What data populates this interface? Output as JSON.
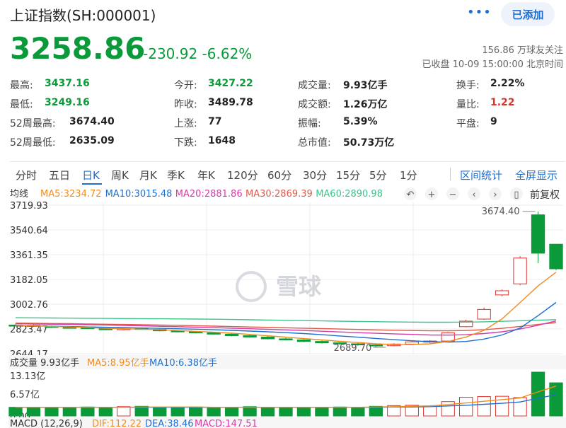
{
  "header": {
    "title": "上证指数(SH:000001)",
    "more_label": "•••",
    "add_label": "已添加",
    "price": "3258.86",
    "change": "-230.92 -6.62%",
    "follow": "156.86 万球友关注",
    "status": "已收盘 10-09 15:00:00 北京时间"
  },
  "stats": [
    [
      {
        "label": "最高:",
        "value": "3437.16",
        "color": "green"
      },
      {
        "label": "今开:",
        "value": "3427.22",
        "color": "green"
      },
      {
        "label": "成交量:",
        "value": "9.93亿手",
        "color": ""
      },
      {
        "label": "换手:",
        "value": "2.22%",
        "color": ""
      }
    ],
    [
      {
        "label": "最低:",
        "value": "3249.16",
        "color": "green"
      },
      {
        "label": "昨收:",
        "value": "3489.78",
        "color": ""
      },
      {
        "label": "成交额:",
        "value": "1.26万亿",
        "color": ""
      },
      {
        "label": "量比:",
        "value": "1.22",
        "color": "red"
      }
    ],
    [
      {
        "label": "52周最高:",
        "value": "3674.40",
        "color": ""
      },
      {
        "label": "上涨:",
        "value": "77",
        "color": ""
      },
      {
        "label": "振幅:",
        "value": "5.39%",
        "color": ""
      },
      {
        "label": "平盘:",
        "value": "9",
        "color": ""
      }
    ],
    [
      {
        "label": "52周最低:",
        "value": "2635.09",
        "color": ""
      },
      {
        "label": "下跌:",
        "value": "1648",
        "color": ""
      },
      {
        "label": "总市值:",
        "value": "50.73万亿",
        "color": ""
      }
    ]
  ],
  "tabs": [
    "分时",
    "五日",
    "日K",
    "周K",
    "月K",
    "季K",
    "年K",
    "120分",
    "60分",
    "30分",
    "15分",
    "5分",
    "1分"
  ],
  "active_tab": "日K",
  "tab_links": [
    "区间统计",
    "全屏显示"
  ],
  "chart_toolbar": {
    "mode": "均线",
    "fq": "前复权",
    "icons": [
      "↶",
      "+",
      "−",
      "‹",
      "›",
      "▯"
    ]
  },
  "watermark": "雪球",
  "colors": {
    "up": "#e0302a",
    "down": "#0a9a3a",
    "ma5": "#f08c1e",
    "ma10": "#1f6fd1",
    "ma20": "#d63ca8",
    "ma30": "#e05a4a",
    "ma60": "#3cc48c"
  },
  "chart_data": {
    "type": "candlestick",
    "price_ticks": [
      "3719.93",
      "3540.64",
      "3361.35",
      "3182.05",
      "3002.76",
      "2823.47",
      "2644.17"
    ],
    "price_range": [
      2644.17,
      3719.93
    ],
    "ma_legend": [
      {
        "name": "MA5",
        "value": "3234.72",
        "key": "ma5"
      },
      {
        "name": "MA10",
        "value": "3015.48",
        "key": "ma10"
      },
      {
        "name": "MA20",
        "value": "2881.86",
        "key": "ma20"
      },
      {
        "name": "MA30",
        "value": "2869.39",
        "key": "ma30"
      },
      {
        "name": "MA60",
        "value": "2890.98",
        "key": "ma60"
      }
    ],
    "annotations": {
      "high": "3674.40",
      "low": "2689.70"
    },
    "candles": [
      {
        "o": 2852,
        "h": 2860,
        "l": 2845,
        "c": 2848
      },
      {
        "o": 2850,
        "h": 2856,
        "l": 2839,
        "c": 2842
      },
      {
        "o": 2842,
        "h": 2848,
        "l": 2830,
        "c": 2835
      },
      {
        "o": 2836,
        "h": 2840,
        "l": 2829,
        "c": 2833
      },
      {
        "o": 2833,
        "h": 2838,
        "l": 2822,
        "c": 2826
      },
      {
        "o": 2826,
        "h": 2832,
        "l": 2815,
        "c": 2818
      },
      {
        "o": 2818,
        "h": 2836,
        "l": 2814,
        "c": 2832
      },
      {
        "o": 2830,
        "h": 2835,
        "l": 2817,
        "c": 2820
      },
      {
        "o": 2820,
        "h": 2826,
        "l": 2806,
        "c": 2810
      },
      {
        "o": 2810,
        "h": 2816,
        "l": 2799,
        "c": 2803
      },
      {
        "o": 2803,
        "h": 2809,
        "l": 2791,
        "c": 2795
      },
      {
        "o": 2795,
        "h": 2800,
        "l": 2782,
        "c": 2786
      },
      {
        "o": 2786,
        "h": 2792,
        "l": 2770,
        "c": 2775
      },
      {
        "o": 2775,
        "h": 2780,
        "l": 2760,
        "c": 2765
      },
      {
        "o": 2765,
        "h": 2770,
        "l": 2748,
        "c": 2752
      },
      {
        "o": 2752,
        "h": 2760,
        "l": 2740,
        "c": 2744
      },
      {
        "o": 2744,
        "h": 2750,
        "l": 2728,
        "c": 2733
      },
      {
        "o": 2733,
        "h": 2740,
        "l": 2718,
        "c": 2723
      },
      {
        "o": 2723,
        "h": 2730,
        "l": 2710,
        "c": 2716
      },
      {
        "o": 2716,
        "h": 2722,
        "l": 2702,
        "c": 2708
      },
      {
        "o": 2708,
        "h": 2715,
        "l": 2690,
        "c": 2702
      },
      {
        "o": 2702,
        "h": 2720,
        "l": 2698,
        "c": 2714
      },
      {
        "o": 2714,
        "h": 2735,
        "l": 2708,
        "c": 2730
      },
      {
        "o": 2730,
        "h": 2742,
        "l": 2722,
        "c": 2736
      },
      {
        "o": 2736,
        "h": 2800,
        "l": 2730,
        "c": 2795
      },
      {
        "o": 2840,
        "h": 2890,
        "l": 2835,
        "c": 2880
      },
      {
        "o": 2895,
        "h": 2978,
        "l": 2890,
        "c": 2965
      },
      {
        "o": 3070,
        "h": 3110,
        "l": 3060,
        "c": 3100
      },
      {
        "o": 3150,
        "h": 3350,
        "l": 3140,
        "c": 3337
      },
      {
        "o": 3650,
        "h": 3674.4,
        "l": 3300,
        "c": 3372
      },
      {
        "o": 3437.16,
        "h": 3437.16,
        "l": 3249.16,
        "c": 3258.86
      }
    ],
    "ma5": [
      2850,
      2846,
      2842,
      2838,
      2833,
      2828,
      2825,
      2822,
      2818,
      2812,
      2806,
      2800,
      2793,
      2784,
      2774,
      2764,
      2754,
      2744,
      2734,
      2725,
      2716,
      2710,
      2711,
      2716,
      2733,
      2765,
      2813,
      2896,
      3015,
      3135,
      3234.72
    ],
    "ma10": [
      2848,
      2846,
      2843,
      2841,
      2838,
      2836,
      2833,
      2830,
      2828,
      2825,
      2822,
      2818,
      2813,
      2808,
      2803,
      2797,
      2790,
      2782,
      2773,
      2764,
      2755,
      2746,
      2738,
      2731,
      2728,
      2733,
      2750,
      2780,
      2830,
      2920,
      3015.48
    ],
    "ma20": [
      2862,
      2860,
      2858,
      2856,
      2854,
      2852,
      2849,
      2846,
      2843,
      2840,
      2837,
      2833,
      2829,
      2825,
      2821,
      2817,
      2812,
      2807,
      2802,
      2797,
      2792,
      2788,
      2784,
      2780,
      2779,
      2782,
      2790,
      2803,
      2823,
      2850,
      2881.86
    ],
    "ma30": [
      2866,
      2865,
      2863,
      2862,
      2860,
      2858,
      2856,
      2854,
      2852,
      2850,
      2847,
      2844,
      2841,
      2838,
      2835,
      2832,
      2829,
      2826,
      2823,
      2820,
      2817,
      2814,
      2812,
      2810,
      2810,
      2812,
      2818,
      2828,
      2842,
      2856,
      2869.39
    ],
    "ma60": [
      2905,
      2904,
      2903,
      2902,
      2901,
      2900,
      2899,
      2898,
      2897,
      2896,
      2895,
      2894,
      2892,
      2890,
      2888,
      2886,
      2884,
      2882,
      2880,
      2878,
      2876,
      2874,
      2873,
      2872,
      2872,
      2873,
      2875,
      2879,
      2883,
      2887,
      2890.98
    ],
    "volume": {
      "label": "成交量 9.93亿手",
      "ma_legend": [
        {
          "name": "MA5",
          "value": "8.95亿手",
          "key": "ma5"
        },
        {
          "name": "MA10",
          "value": "6.38亿手",
          "key": "ma10"
        }
      ],
      "ticks": [
        "13.13亿",
        "6.57亿",
        "0.00"
      ],
      "max": 13.13,
      "values": [
        2.6,
        2.5,
        2.6,
        2.6,
        2.7,
        2.5,
        2.8,
        2.9,
        2.6,
        2.5,
        2.7,
        2.6,
        2.6,
        2.8,
        2.6,
        2.5,
        2.6,
        2.6,
        2.7,
        2.6,
        2.9,
        3.1,
        3.2,
        3.0,
        4.3,
        5.6,
        5.8,
        5.9,
        5.5,
        13.13,
        9.93
      ],
      "ma5": [
        2.6,
        2.6,
        2.6,
        2.6,
        2.6,
        2.6,
        2.6,
        2.7,
        2.7,
        2.7,
        2.7,
        2.6,
        2.6,
        2.6,
        2.6,
        2.6,
        2.6,
        2.6,
        2.6,
        2.6,
        2.7,
        2.8,
        2.9,
        3.0,
        3.4,
        3.9,
        4.4,
        4.9,
        5.4,
        7.2,
        8.95
      ],
      "ma10": [
        2.6,
        2.6,
        2.6,
        2.6,
        2.6,
        2.6,
        2.6,
        2.6,
        2.6,
        2.6,
        2.6,
        2.6,
        2.6,
        2.6,
        2.6,
        2.6,
        2.6,
        2.6,
        2.6,
        2.6,
        2.6,
        2.7,
        2.7,
        2.8,
        3.0,
        3.2,
        3.5,
        3.8,
        4.2,
        5.3,
        6.38
      ]
    },
    "macd": {
      "label": "MACD (12,26,9)",
      "dif": "DIF:112.22",
      "dea": "DEA:38.46",
      "macd": "MACD:147.51"
    }
  }
}
